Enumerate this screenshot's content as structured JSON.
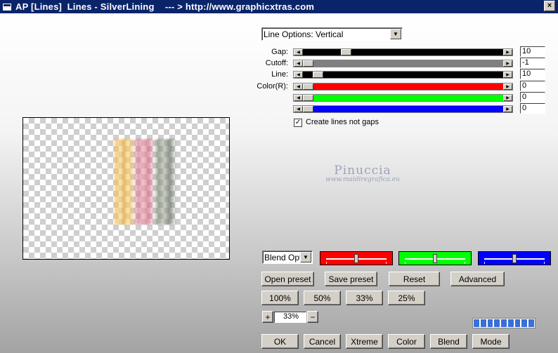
{
  "window": {
    "title": "AP [Lines]  Lines - SilverLining    --- > http://www.graphicxtras.com",
    "close_glyph": "×"
  },
  "options": {
    "line_options_value": "Line Options: Vertical"
  },
  "sliders": [
    {
      "label": "Gap:",
      "value": "10",
      "position": 0.2,
      "fill": "#000000"
    },
    {
      "label": "Cutoff:",
      "value": "-1",
      "position": 0.0,
      "fill": "#808080"
    },
    {
      "label": "Line:",
      "value": "10",
      "position": 0.05,
      "fill": "#000000"
    },
    {
      "label": "Color(R):",
      "value": "0",
      "position": 0.0,
      "fill": "#ff0000"
    },
    {
      "label": "",
      "value": "0",
      "position": 0.0,
      "fill": "#00ff00"
    },
    {
      "label": "",
      "value": "0",
      "position": 0.0,
      "fill": "#0000ff"
    }
  ],
  "checkbox": {
    "label": "Create lines not gaps",
    "checked": true,
    "mark": "✓"
  },
  "watermark": {
    "line1": "Pinuccia",
    "line2": "www.maidiregrafica.eu"
  },
  "blend": {
    "select_value": "Blend Optio",
    "color_boxes": [
      {
        "color": "#ff0000",
        "position": 0.5
      },
      {
        "color": "#00ff00",
        "position": 0.5
      },
      {
        "color": "#0000ff",
        "position": 0.5
      }
    ]
  },
  "buttons": {
    "open_preset": "Open preset",
    "save_preset": "Save preset",
    "reset": "Reset",
    "advanced": "Advanced",
    "zoom_100": "100%",
    "zoom_50": "50%",
    "zoom_33": "33%",
    "zoom_25": "25%",
    "ok": "OK",
    "cancel": "Cancel",
    "xtreme": "Xtreme",
    "color": "Color",
    "blend": "Blend",
    "mode": "Mode"
  },
  "zoom": {
    "plus": "+",
    "minus": "−",
    "value": "33%"
  },
  "progress": {
    "blocks": 9
  }
}
